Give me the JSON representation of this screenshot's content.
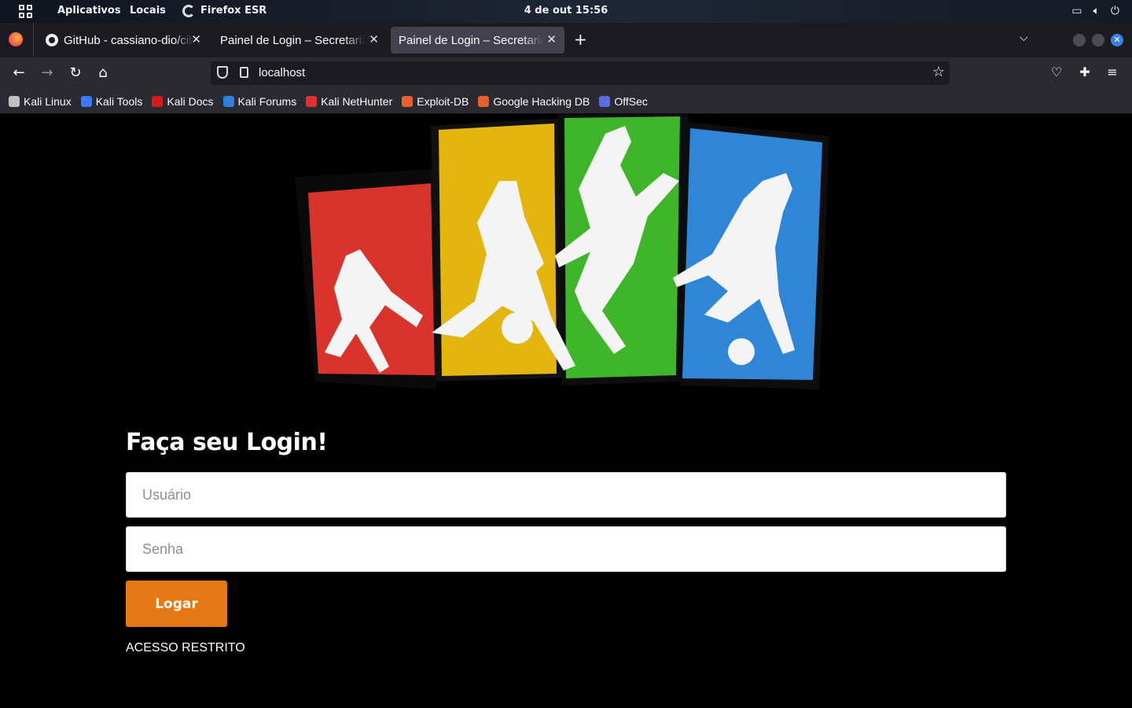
{
  "system_bar": {
    "apps_label": "Aplicativos",
    "places_label": "Locais",
    "active_app": "Firefox ESR",
    "clock": "4 de out  15:56"
  },
  "tabs": [
    {
      "title": "GitHub - cassiano-dio/cib",
      "active": false
    },
    {
      "title": "Painel de Login – Secretaria d",
      "active": false
    },
    {
      "title": "Painel de Login – Secretaria d",
      "active": true
    }
  ],
  "nav": {
    "url": "localhost"
  },
  "bookmarks": [
    {
      "label": "Kali Linux",
      "icon": "kali-dragon-icon",
      "color": "#c0c0c0"
    },
    {
      "label": "Kali Tools",
      "icon": "kali-tools-icon",
      "color": "#3b78ff"
    },
    {
      "label": "Kali Docs",
      "icon": "kali-docs-icon",
      "color": "#d61a1a"
    },
    {
      "label": "Kali Forums",
      "icon": "kali-forums-icon",
      "color": "#2f7fe0"
    },
    {
      "label": "Kali NetHunter",
      "icon": "kali-nethunter-icon",
      "color": "#e03131"
    },
    {
      "label": "Exploit-DB",
      "icon": "exploit-db-icon",
      "color": "#e8612c"
    },
    {
      "label": "Google Hacking DB",
      "icon": "ghdb-icon",
      "color": "#e8612c"
    },
    {
      "label": "OffSec",
      "icon": "offsec-icon",
      "color": "#5b6ee1"
    }
  ],
  "page": {
    "heading": "Faça seu Login!",
    "username_placeholder": "Usuário",
    "password_placeholder": "Senha",
    "submit_label": "Logar",
    "footer_text": "ACESSO RESTRITO"
  },
  "colors": {
    "accent_button": "#e47913",
    "page_background": "#000000"
  }
}
